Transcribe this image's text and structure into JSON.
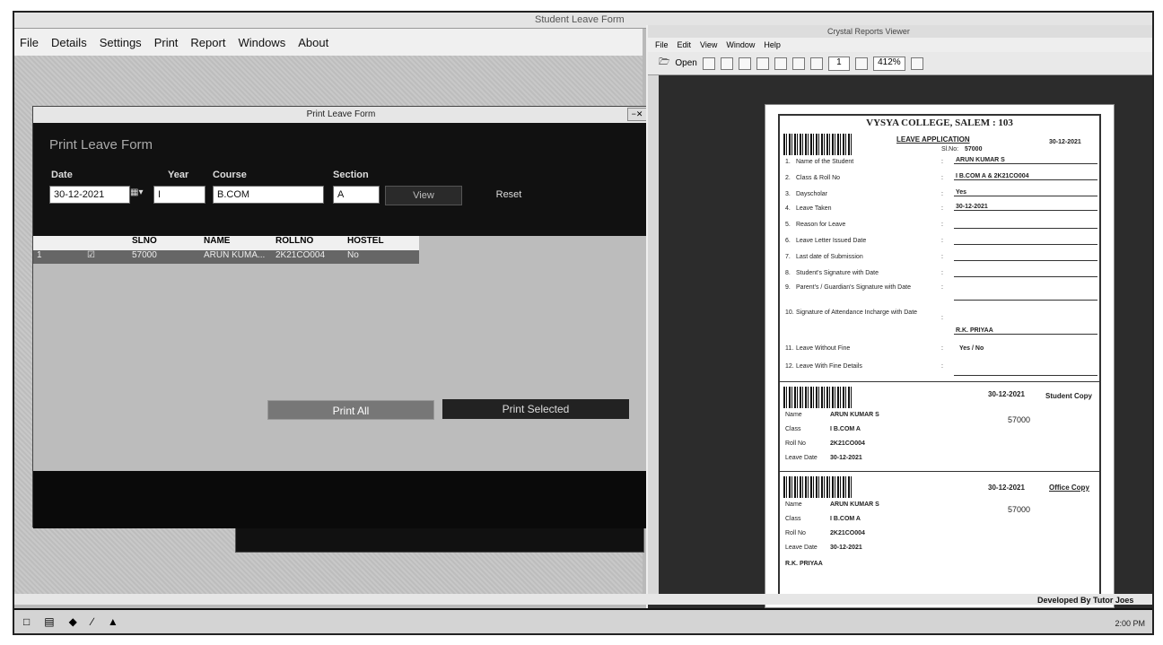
{
  "app": {
    "title": "Student Leave Form",
    "menu": [
      "File",
      "Details",
      "Settings",
      "Print",
      "Report",
      "Windows",
      "About"
    ]
  },
  "dialog": {
    "title": "Print Leave Form",
    "heading": "Print Leave Form",
    "labels": {
      "date": "Date",
      "year": "Year",
      "course": "Course",
      "section": "Section"
    },
    "values": {
      "date": "30-12-2021",
      "year": "I",
      "course": "B.COM",
      "section": "A"
    },
    "view": "View",
    "reset": "Reset",
    "grid": {
      "columns": [
        "SLNO",
        "NAME",
        "ROLLNO",
        "HOSTEL"
      ],
      "row": {
        "index": "1",
        "slno": "57000",
        "name": "ARUN KUMA...",
        "rollno": "2K21CO004",
        "hostel": "No"
      }
    },
    "print_all": "Print All",
    "print_selected": "Print Selected"
  },
  "crystal": {
    "title": "Crystal Reports Viewer",
    "menu": [
      "File",
      "Edit",
      "View",
      "Window",
      "Help"
    ],
    "open": "Open",
    "page": "1",
    "zoom": "412%"
  },
  "report": {
    "college": "VYSYA COLLEGE, SALEM : 103",
    "app_title": "LEAVE APPLICATION",
    "date": "30-12-2021",
    "slno_label": "Sl.No:",
    "slno": "57000",
    "items": [
      {
        "n": "1.",
        "label": "Name of the Student",
        "value": "ARUN KUMAR S"
      },
      {
        "n": "2.",
        "label": "Class & Roll No",
        "value": "I B.COM A & 2K21CO004"
      },
      {
        "n": "3.",
        "label": "Dayscholar",
        "value": "Yes"
      },
      {
        "n": "4.",
        "label": "Leave Taken",
        "value": "30-12-2021"
      },
      {
        "n": "5.",
        "label": "Reason for Leave",
        "value": ""
      },
      {
        "n": "6.",
        "label": "Leave Letter Issued Date",
        "value": ""
      },
      {
        "n": "7.",
        "label": "Last date of Submission",
        "value": ""
      },
      {
        "n": "8.",
        "label": "Student's Signature with Date",
        "value": ""
      },
      {
        "n": "9.",
        "label": "Parent's / Guardian's Signature with Date",
        "value": ""
      },
      {
        "n": "10.",
        "label": "Signature of Attendance Incharge with Date",
        "value": "R.K. PRIYAA"
      },
      {
        "n": "11.",
        "label": "Leave Without Fine",
        "value": "Yes / No"
      },
      {
        "n": "12.",
        "label": "Leave With Fine Details",
        "value": ""
      }
    ],
    "student_copy": "Student Copy",
    "office_copy": "Office Copy",
    "copy_labels": {
      "name": "Name",
      "class": "Class",
      "rollno": "Roll No",
      "leave_date": "Leave Date"
    },
    "copy_values": {
      "name": "ARUN KUMAR S",
      "class": "I B.COM A",
      "rollno": "2K21CO004",
      "leave_date": "30-12-2021"
    },
    "sno": "57000",
    "incharge": "R.K. PRIYAA"
  },
  "footer": {
    "developer": "Developed By Tutor Joes",
    "clock": "2:00 PM"
  }
}
